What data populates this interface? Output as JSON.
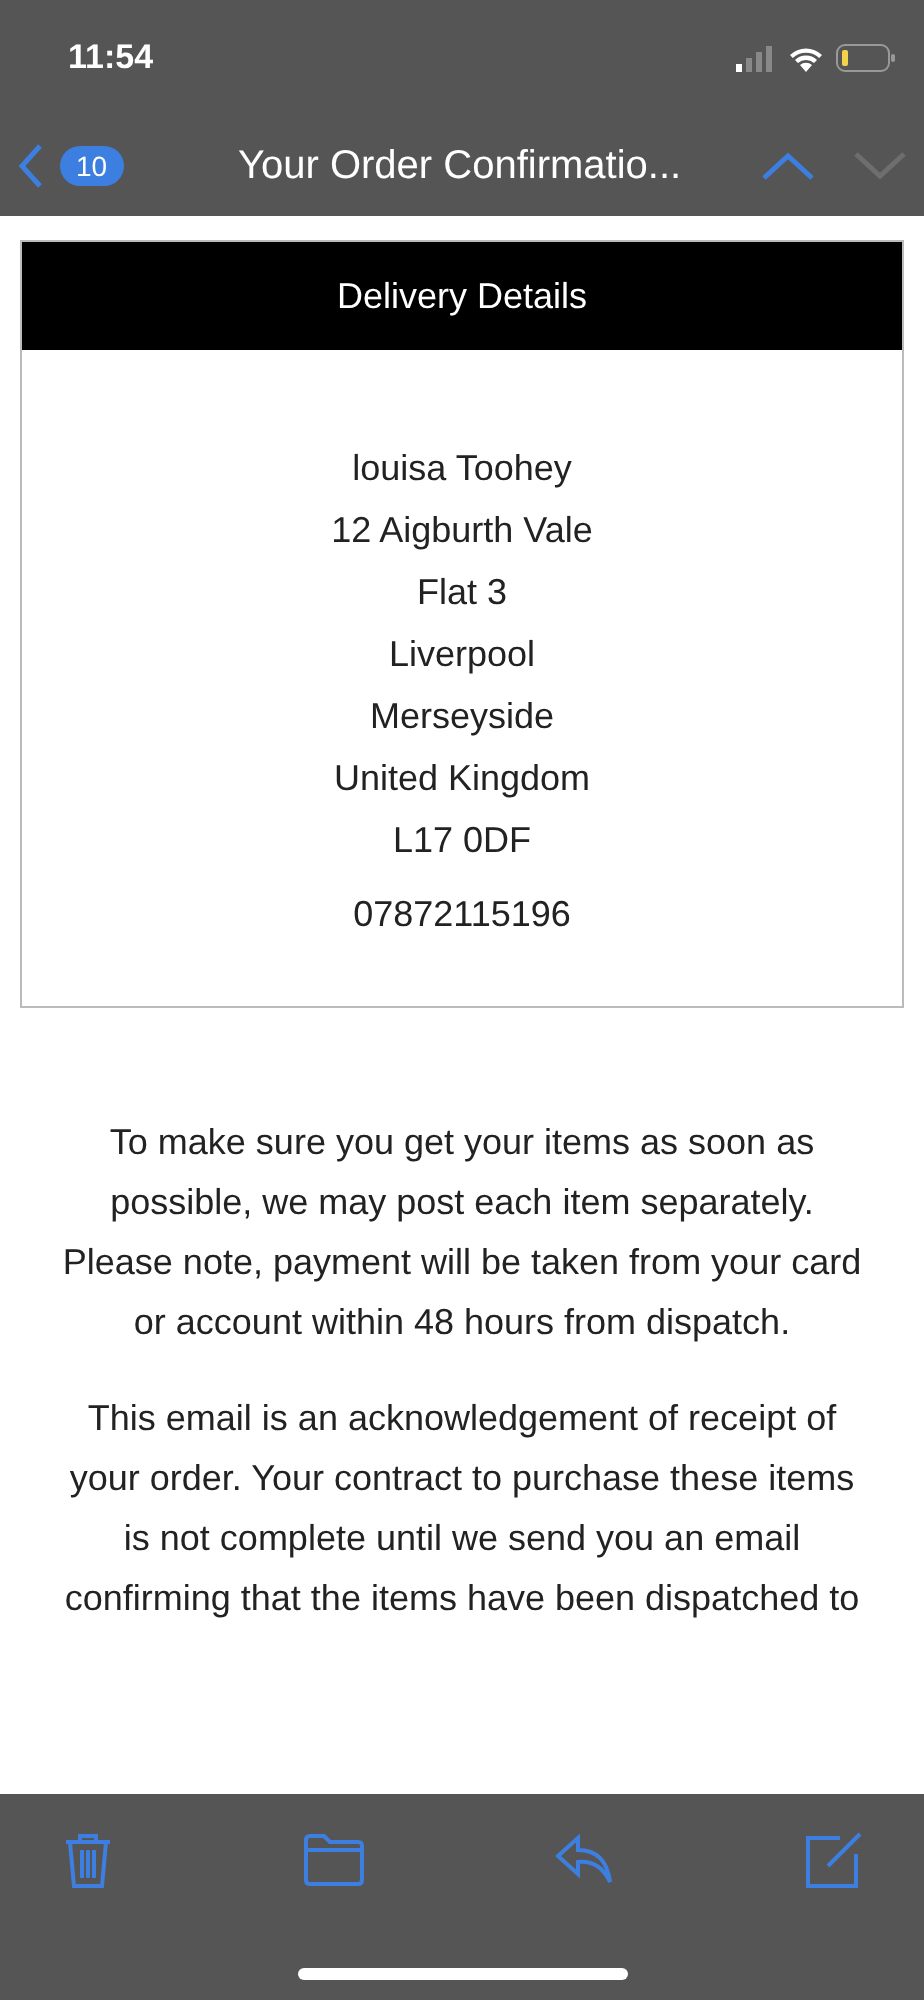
{
  "status_bar": {
    "time": "11:54"
  },
  "nav": {
    "back_count": "10",
    "title": "Your Order Confirmatio...",
    "up": {
      "disabled": false
    },
    "down": {
      "disabled": true
    }
  },
  "delivery": {
    "heading": "Delivery Details",
    "address_lines": [
      "louisa Toohey",
      "12 Aigburth Vale",
      "Flat 3",
      "Liverpool",
      "Merseyside",
      "United Kingdom",
      "L17 0DF"
    ],
    "phone": "07872115196"
  },
  "paragraphs": [
    "To make sure you get your items as soon as possible, we may post each item separately. Please note, payment will be taken from your card or account within 48 hours from dispatch.",
    "This email is an acknowledgement of receipt of your order. Your contract to purchase these items is not complete until we send you an email confirming that the items have been dispatched to"
  ],
  "toolbar": [
    {
      "kind": "trash"
    },
    {
      "kind": "folder"
    },
    {
      "kind": "reply"
    },
    {
      "kind": "compose"
    }
  ]
}
